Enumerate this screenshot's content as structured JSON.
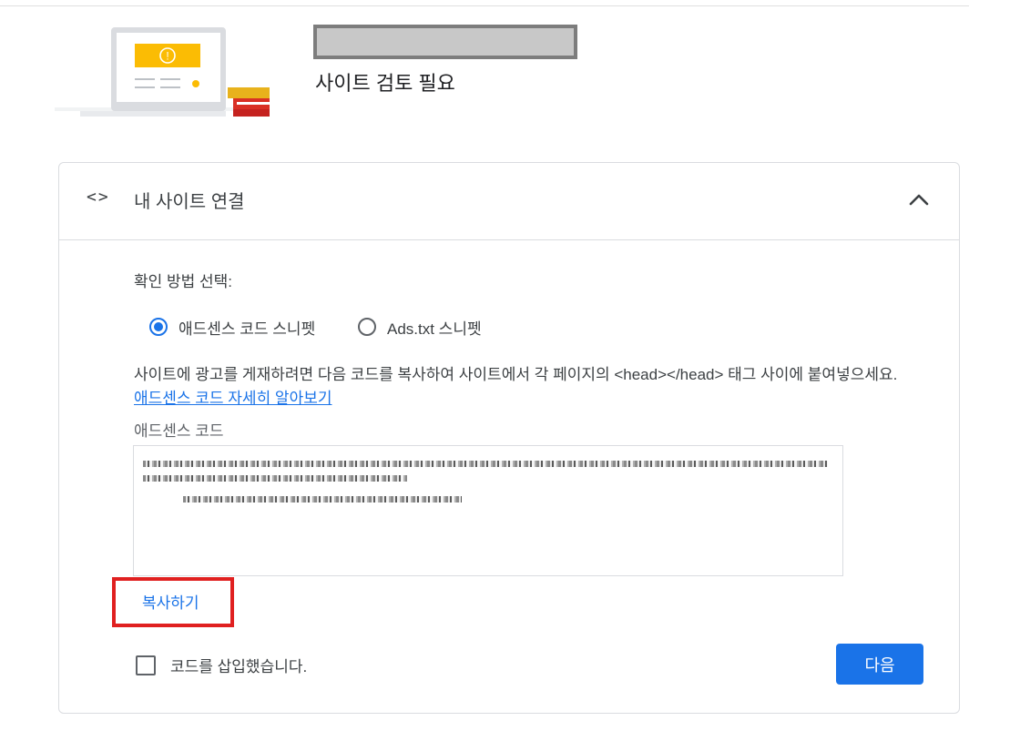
{
  "header": {
    "status": "사이트 검토 필요",
    "illustration_alert_glyph": "!"
  },
  "panel": {
    "title": "내 사이트 연결",
    "code_icon": "<>",
    "collapse_icon": "chevron-up-icon"
  },
  "verification": {
    "label": "확인 방법 선택:",
    "options": [
      {
        "label": "애드센스 코드 스니펫",
        "selected": true
      },
      {
        "label": "Ads.txt 스니펫",
        "selected": false
      }
    ]
  },
  "instructions": {
    "text": "사이트에 광고를 게재하려면 다음 코드를 복사하여 사이트에서 각 페이지의 <head></head> 태그 사이에 붙여넣으세요. ",
    "link_text": "애드센스 코드 자세히 알아보기"
  },
  "code": {
    "label": "애드센스 코드"
  },
  "actions": {
    "copy_label": "복사하기",
    "checkbox_label": "코드를 삽입했습니다.",
    "checkbox_checked": false,
    "next_label": "다음"
  },
  "colors": {
    "accent": "#1a73e8",
    "highlight": "#e02020",
    "alert": "#fbbc04"
  }
}
